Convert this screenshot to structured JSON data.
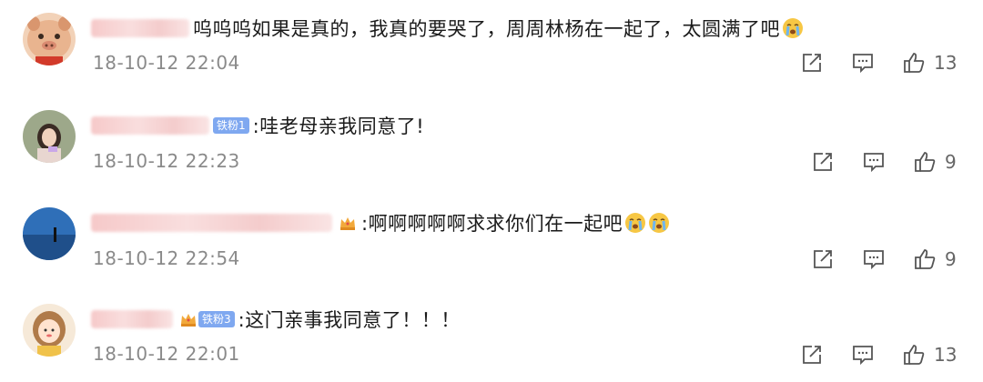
{
  "comments": [
    {
      "avatar": "pig-avatar",
      "text": "呜呜呜如果是真的，我真的要哭了，周周林杨在一起了，太圆满了吧",
      "emojis": [
        "crying-face-icon"
      ],
      "badge": "",
      "time": "18-10-12 22:04",
      "likes": "13"
    },
    {
      "avatar": "girl-avatar",
      "text": ":哇老母亲我同意了!",
      "emojis": [],
      "badge": "铁粉1",
      "time": "18-10-12 22:23",
      "likes": "9"
    },
    {
      "avatar": "sea-avatar",
      "text": ":啊啊啊啊啊求求你们在一起吧",
      "emojis": [
        "crying-face-icon",
        "crying-face-icon"
      ],
      "badge": "",
      "time": "18-10-12 22:54",
      "likes": "9"
    },
    {
      "avatar": "cartoon-girl-avatar",
      "text": ":这门亲事我同意了！！！",
      "emojis": [],
      "badge": "铁粉3",
      "time": "18-10-12 22:01",
      "likes": "13"
    }
  ],
  "colors": {
    "time": "#8a8a8a",
    "badge": "#7fa8f0",
    "icon": "#555555"
  },
  "icons": {
    "forward": "share-icon",
    "comment": "comment-icon",
    "like": "thumbs-up-icon"
  }
}
